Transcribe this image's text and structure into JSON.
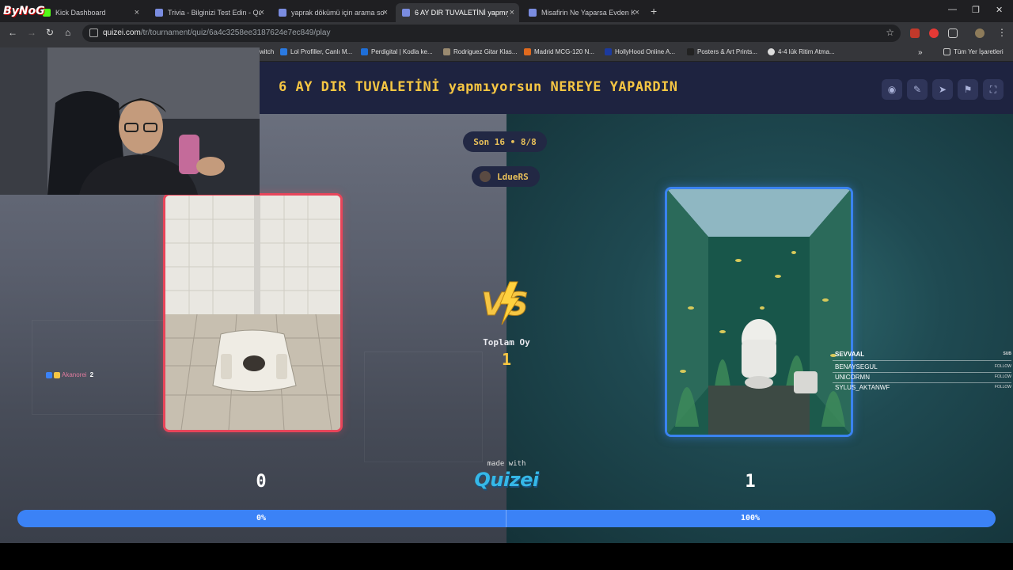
{
  "browser": {
    "tabs": [
      {
        "label": "Kick Dashboard",
        "active": false
      },
      {
        "label": "Trivia - Bilginizi Test Edin - Quiz",
        "active": false
      },
      {
        "label": "yaprak dökümü için arama sonu",
        "active": false
      },
      {
        "label": "6 AY DIR TUVALETİNİ yapmıyorsu",
        "active": true
      },
      {
        "label": "Misafirin Ne Yaparsa Evden Kov",
        "active": false
      }
    ],
    "url_host": "quizei.com",
    "url_path": "/tr/tournament/quiz/6a4c3258ee3187624e7ec849/play",
    "bookmarks": [
      "witch",
      "Lol Profiller, Canlı M...",
      "Perdigital | Kodla ke...",
      "Rodriguez Gitar Klas...",
      "Madrid MCG-120 N...",
      "HollyHood Online A...",
      "Posters & Art Prints...",
      "4-4 lük Ritim Atma..."
    ],
    "bookmarks_folder": "Tüm Yer İşaretleri"
  },
  "quiz": {
    "title": "6 AY DIR TUVALETİNİ yapmıyorsun NEREYE YAPARDIN",
    "round_label": "Son 16 • 8/8",
    "username": "LdueRS",
    "vs_label": "VS",
    "total_label": "Toplam Oy",
    "total_value": "1",
    "left": {
      "score": "0",
      "percent_label": "0%",
      "share": 0
    },
    "right": {
      "score": "1",
      "percent_label": "100%",
      "share": 1
    },
    "made_with": "made with",
    "brand": "Quizei"
  },
  "overlay": {
    "channel": "ByNoG",
    "chat_user": "Akanorei",
    "chat_count": "2",
    "subs": [
      {
        "name": "SEVVAAL",
        "tag": "SUB"
      },
      {
        "name": "BENAYSEGUL",
        "tag": "FOLLOW"
      },
      {
        "name": "UNICORMN",
        "tag": "FOLLOW"
      },
      {
        "name": "SYLUS_AKTANWF",
        "tag": "FOLLOW"
      }
    ]
  },
  "colors": {
    "accent_yellow": "#f6c643",
    "left_border": "#e8455a",
    "right_border": "#3a83f0",
    "progress": "#3b82f6",
    "header_bg": "#1e2340"
  },
  "icons": [
    "eye-icon",
    "edit-icon",
    "send-icon",
    "flag-icon",
    "fullscreen-icon"
  ]
}
